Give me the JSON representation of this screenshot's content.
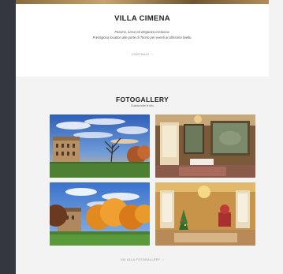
{
  "intro": {
    "title": "VILLA CIMENA",
    "line1": "Fascino, lusso ed eleganza esclusiva.",
    "line2": "Prestigiosa location alle porte di Torino per eventi al altissimo livello.",
    "more_label": "CONTINUO",
    "more_icon": "chevron-right-icon"
  },
  "gallery": {
    "title": "FOTOGALLERY",
    "subtitle": "Guarda tutte le foto",
    "photos": [
      {
        "name": "villa-exterior-sunset"
      },
      {
        "name": "salon-interior-paintings"
      },
      {
        "name": "villa-park-autumn"
      },
      {
        "name": "ballroom-christmas-tree"
      }
    ],
    "cta_label": "VAI ALLA FOTOGALLERY",
    "cta_icon": "chevron-right-icon"
  }
}
